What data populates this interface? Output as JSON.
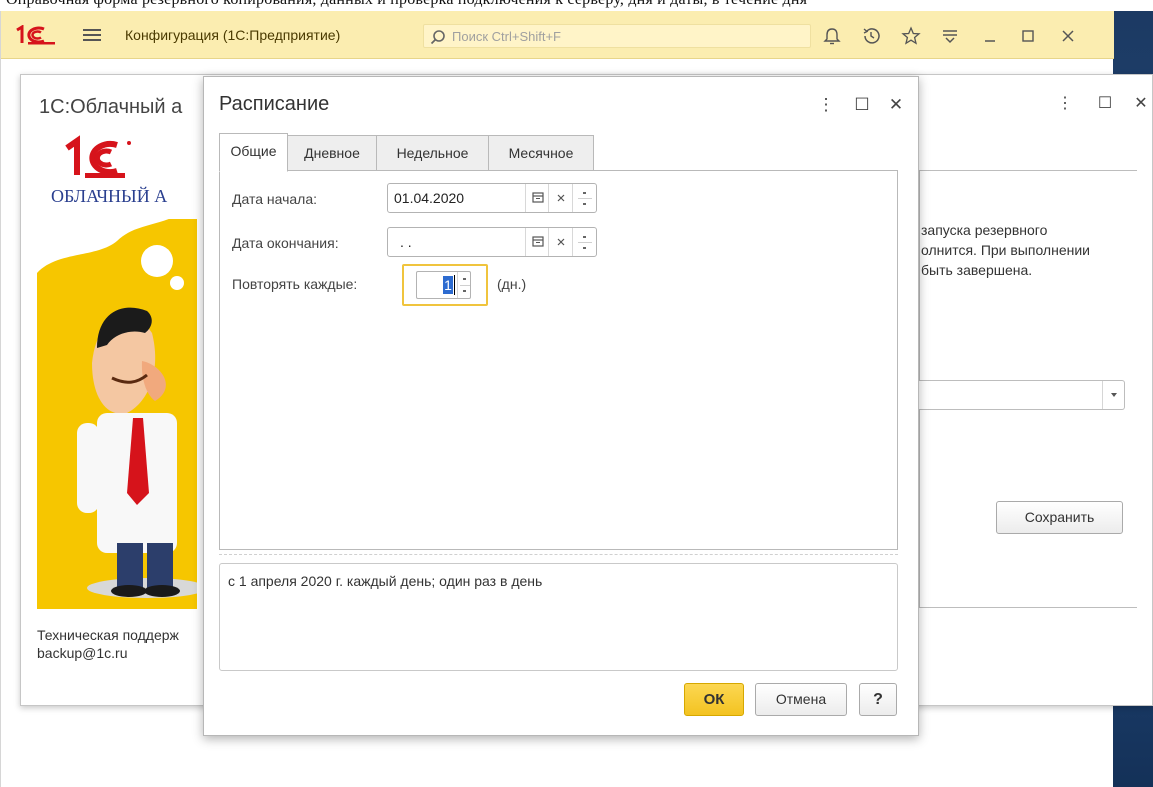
{
  "window": {
    "title": "Конфигурация  (1С:Предприятие)",
    "search_placeholder": "Поиск Ctrl+Shift+F",
    "icons": [
      "bell-icon",
      "history-icon",
      "star-icon",
      "menu-more-icon",
      "minimize-icon",
      "maximize-icon",
      "close-icon"
    ],
    "colors": {
      "titlebar": "#fbedb0",
      "logo_red": "#d6131b",
      "accent_yellow": "#f6c600"
    }
  },
  "background_form": {
    "title": "1С:Облачный а",
    "logo_caption": "ОБЛАЧНЫЙ А",
    "support_line1": "Техническая поддерж",
    "support_line2": "backup@1c.ru",
    "text_lines": [
      "запуска резервного",
      "олнится. При выполнении",
      "быть завершена."
    ],
    "select_value": "",
    "save_label": "Сохранить"
  },
  "dialog": {
    "title": "Расписание",
    "tabs": [
      {
        "label": "Общие",
        "active": true
      },
      {
        "label": "Дневное",
        "active": false
      },
      {
        "label": "Недельное",
        "active": false
      },
      {
        "label": "Месячное",
        "active": false
      }
    ],
    "start_date_label": "Дата начала:",
    "start_date_value": "01.04.2020",
    "end_date_label": "Дата окончания:",
    "end_date_value": " .  .",
    "repeat_label": "Повторять каждые:",
    "repeat_value": "1",
    "repeat_unit": "(дн.)",
    "summary": "с 1 апреля 2020 г. каждый день; один раз в день",
    "ok_label": "ОК",
    "cancel_label": "Отмена",
    "help_label": "?"
  },
  "top_strip_text": "Оправочная форма резервного копирования, данных и проверка подключения к серверу, дня и даты, в течение дня"
}
